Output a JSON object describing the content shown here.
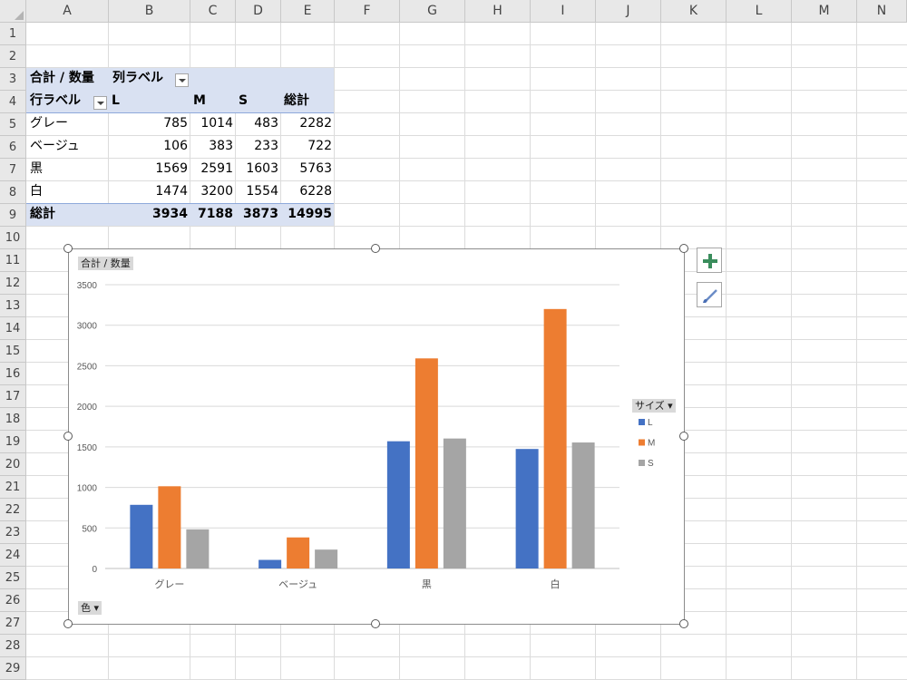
{
  "columns": [
    "A",
    "B",
    "C",
    "D",
    "E",
    "F",
    "G",
    "H",
    "I",
    "J",
    "K",
    "L",
    "M",
    "N"
  ],
  "rows": [
    "1",
    "2",
    "3",
    "4",
    "5",
    "6",
    "7",
    "8",
    "9",
    "10",
    "11",
    "12",
    "13",
    "14",
    "15",
    "16",
    "17",
    "18",
    "19",
    "20",
    "21",
    "22",
    "23",
    "24",
    "25",
    "26",
    "27",
    "28",
    "29"
  ],
  "pivot": {
    "r3": {
      "a": "合計 / 数量",
      "b": "列ラベル"
    },
    "r4": {
      "a": "行ラベル",
      "b": "L",
      "c": "M",
      "d": "S",
      "e": "総計"
    },
    "data": [
      {
        "label": "グレー",
        "l": "785",
        "m": "1014",
        "s": "483",
        "t": "2282"
      },
      {
        "label": "ベージュ",
        "l": "106",
        "m": "383",
        "s": "233",
        "t": "722"
      },
      {
        "label": "黒",
        "l": "1569",
        "m": "2591",
        "s": "1603",
        "t": "5763"
      },
      {
        "label": "白",
        "l": "1474",
        "m": "3200",
        "s": "1554",
        "t": "6228"
      }
    ],
    "total": {
      "label": "総計",
      "l": "3934",
      "m": "7188",
      "s": "3873",
      "t": "14995"
    }
  },
  "chart_field_buttons": {
    "values": "合計 / 数量",
    "legend": "サイズ ▾",
    "axis": "色 ▾"
  },
  "chart_data": {
    "type": "bar",
    "categories": [
      "グレー",
      "ベージュ",
      "黒",
      "白"
    ],
    "series": [
      {
        "name": "L",
        "values": [
          785,
          106,
          1569,
          1474
        ],
        "color": "#4472c4"
      },
      {
        "name": "M",
        "values": [
          1014,
          383,
          2591,
          3200
        ],
        "color": "#ed7d31"
      },
      {
        "name": "S",
        "values": [
          483,
          233,
          1603,
          1554
        ],
        "color": "#a5a5a5"
      }
    ],
    "ylim": [
      0,
      3500
    ],
    "yticks": [
      "0",
      "500",
      "1000",
      "1500",
      "2000",
      "2500",
      "3000",
      "3500"
    ],
    "grid": true,
    "legend": "right"
  },
  "side_buttons": {
    "add": "chart-elements",
    "style": "chart-styles"
  }
}
